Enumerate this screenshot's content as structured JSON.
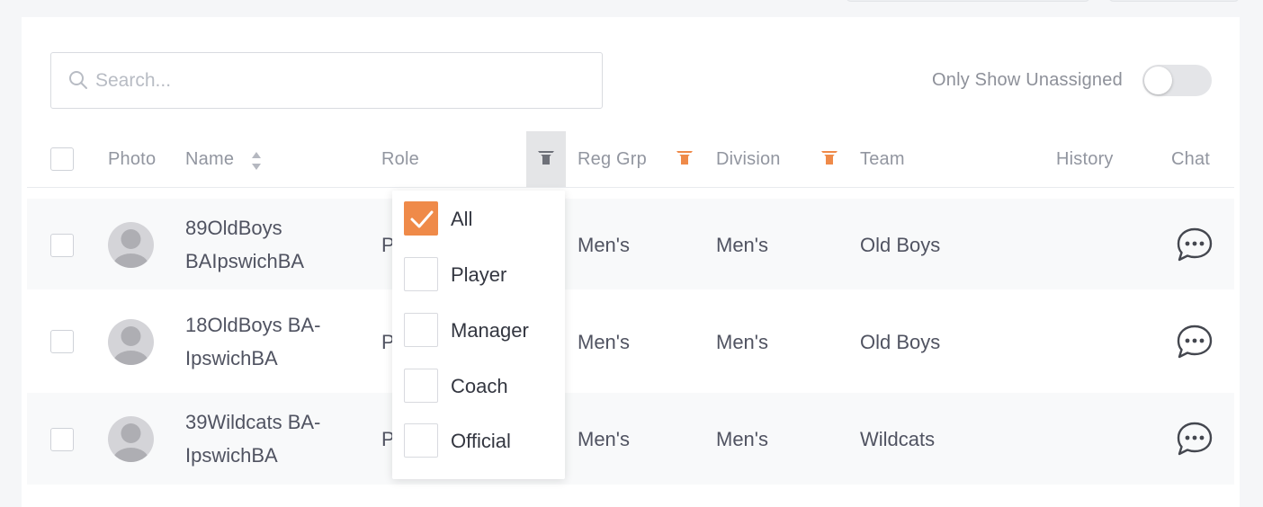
{
  "search": {
    "placeholder": "Search...",
    "value": ""
  },
  "toggle": {
    "label": "Only Show Unassigned",
    "on": false
  },
  "columns": {
    "photo": "Photo",
    "name": "Name",
    "role": "Role",
    "reg_grp": "Reg Grp",
    "division": "Division",
    "team": "Team",
    "history": "History",
    "chat": "Chat"
  },
  "rows": [
    {
      "name": "89OldBoys BAIpswichBA",
      "role": "P",
      "reg_grp": "Men's",
      "division": "Men's",
      "team": "Old Boys"
    },
    {
      "name": "18OldBoys BA-IpswichBA",
      "role": "P",
      "reg_grp": "Men's",
      "division": "Men's",
      "team": "Old Boys"
    },
    {
      "name": "39Wildcats BA-IpswichBA",
      "role": "P",
      "reg_grp": "Men's",
      "division": "Men's",
      "team": "Wildcats"
    }
  ],
  "role_filter": {
    "options": [
      {
        "label": "All",
        "checked": true
      },
      {
        "label": "Player",
        "checked": false
      },
      {
        "label": "Manager",
        "checked": false
      },
      {
        "label": "Coach",
        "checked": false
      },
      {
        "label": "Official",
        "checked": false
      }
    ]
  },
  "colors": {
    "accent": "#ef8a49",
    "text": "#505361",
    "muted": "#9296a0",
    "row_bg": "#f8f9fa"
  }
}
